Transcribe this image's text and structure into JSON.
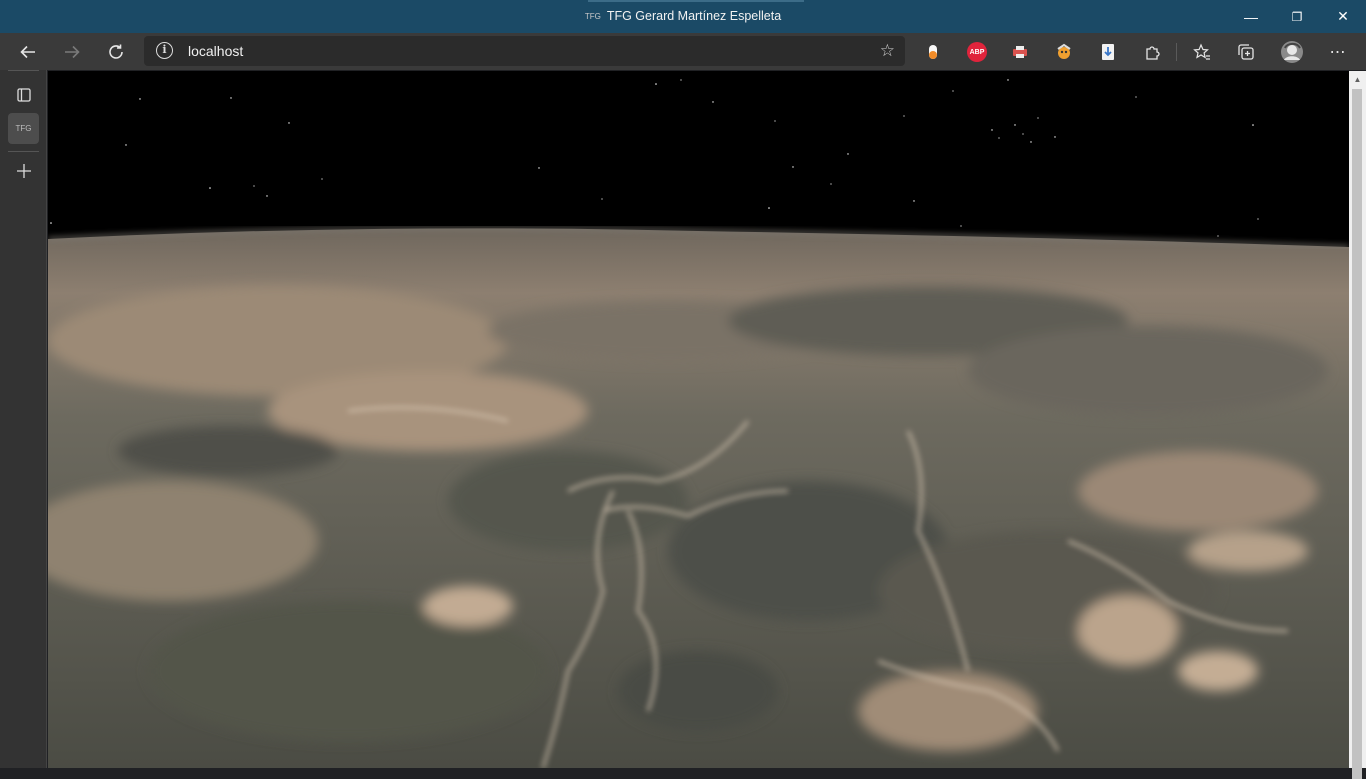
{
  "window": {
    "title": "TFG Gerard Martínez Espelleta",
    "favicon_text": "TFG",
    "controls": {
      "minimize": "—",
      "restore": "❐",
      "close": "✕"
    }
  },
  "toolbar": {
    "address_url": "localhost",
    "buttons": [
      "back-icon",
      "forward-icon",
      "refresh-icon"
    ],
    "extensions": [
      {
        "name": "ext-orange-icon",
        "label": "",
        "color": "#f28c28"
      },
      {
        "name": "adblock-plus-icon",
        "label": "ABP",
        "color": "#e0243c"
      },
      {
        "name": "ext-printer-icon",
        "label": "",
        "color": "#d9534f"
      },
      {
        "name": "ext-face-icon",
        "label": "",
        "color": "#f0a030"
      },
      {
        "name": "ext-download-icon",
        "label": "",
        "color": "#3a77c9"
      }
    ]
  },
  "sidebar": {
    "tab_label": "TFG",
    "items": [
      "tab-actions-icon",
      "tab-tfg",
      "new-tab-icon"
    ]
  },
  "scene": {
    "sky_color": "#000000",
    "terrain_colors": [
      "#8a7b6a",
      "#5d5e55",
      "#b19c86",
      "#44463f"
    ]
  }
}
